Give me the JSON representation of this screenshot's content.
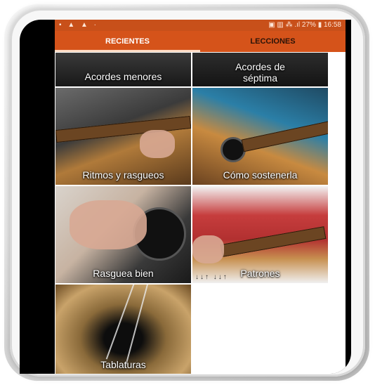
{
  "status_bar": {
    "left_icons": "▪ ▲ ▲ ·",
    "right_text": "▣ ▥ ⁂ .ıl 27% ▮ 16:58"
  },
  "tabs": [
    {
      "label": "RECIENTES",
      "active": true
    },
    {
      "label": "LECCIONES",
      "active": false
    }
  ],
  "lessons": [
    {
      "label": "Acordes menores"
    },
    {
      "label_line1": "Acordes de",
      "label_line2": "séptima"
    },
    {
      "label": "Ritmos y rasgueos"
    },
    {
      "label": "Cómo sostenerla"
    },
    {
      "label": "Rasguea bien"
    },
    {
      "label": "Patrones"
    },
    {
      "label": "Tablaturas"
    }
  ],
  "colors": {
    "accent": "#d5531a",
    "status_bar": "#c8501a"
  },
  "icons": [
    "bell-icon",
    "warning-icon",
    "battery-icon",
    "signal-icon",
    "wifi-icon"
  ]
}
